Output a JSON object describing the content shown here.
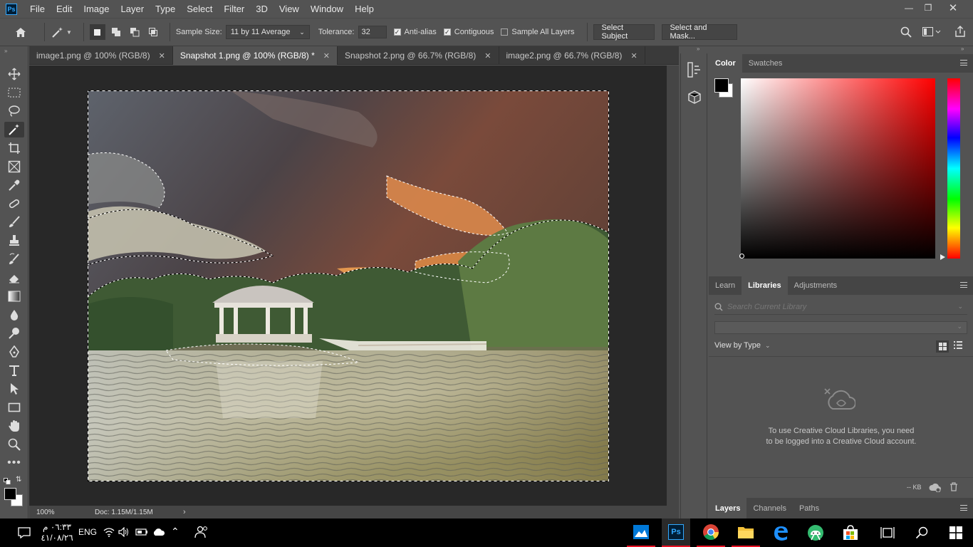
{
  "app": {
    "logo_text": "Ps"
  },
  "menu": [
    "File",
    "Edit",
    "Image",
    "Layer",
    "Type",
    "Select",
    "Filter",
    "3D",
    "View",
    "Window",
    "Help"
  ],
  "options": {
    "sample_size_label": "Sample Size:",
    "sample_size_value": "11 by 11 Average",
    "tolerance_label": "Tolerance:",
    "tolerance_value": "32",
    "anti_alias_label": "Anti-alias",
    "anti_alias_checked": true,
    "contiguous_label": "Contiguous",
    "contiguous_checked": true,
    "sample_all_layers_label": "Sample All Layers",
    "sample_all_layers_checked": false,
    "select_subject_label": "Select Subject",
    "select_and_mask_label": "Select and Mask..."
  },
  "tabs": [
    {
      "label": "image1.png @ 100% (RGB/8)",
      "active": false
    },
    {
      "label": "Snapshot 1.png @ 100% (RGB/8) *",
      "active": true
    },
    {
      "label": "Snapshot 2.png @ 66.7% (RGB/8)",
      "active": false
    },
    {
      "label": "image2.png @ 66.7% (RGB/8)",
      "active": false
    }
  ],
  "status": {
    "zoom": "100%",
    "doc": "Doc: 1.15M/1.15M"
  },
  "color_panel": {
    "tabs": [
      "Color",
      "Swatches"
    ],
    "active_tab": "Color",
    "hue_color": "#ff0000"
  },
  "libraries_panel": {
    "tabs": [
      "Learn",
      "Libraries",
      "Adjustments"
    ],
    "active_tab": "Libraries",
    "search_placeholder": "Search Current Library",
    "view_by": "View by Type",
    "message": "To use Creative Cloud Libraries, you need to be logged into a Creative Cloud account.",
    "size": "-- KB"
  },
  "layers_panel": {
    "tabs": [
      "Layers",
      "Channels",
      "Paths"
    ],
    "active_tab": "Layers"
  },
  "taskbar": {
    "language": "ENG",
    "time": "٠٦:٣٣ م",
    "date": "٤١/٠٨/٢٦"
  },
  "colors": {
    "ui_bg": "#535353",
    "dark_bg": "#282828",
    "ps_blue": "#31a8ff",
    "accent_red": "#e81123"
  }
}
